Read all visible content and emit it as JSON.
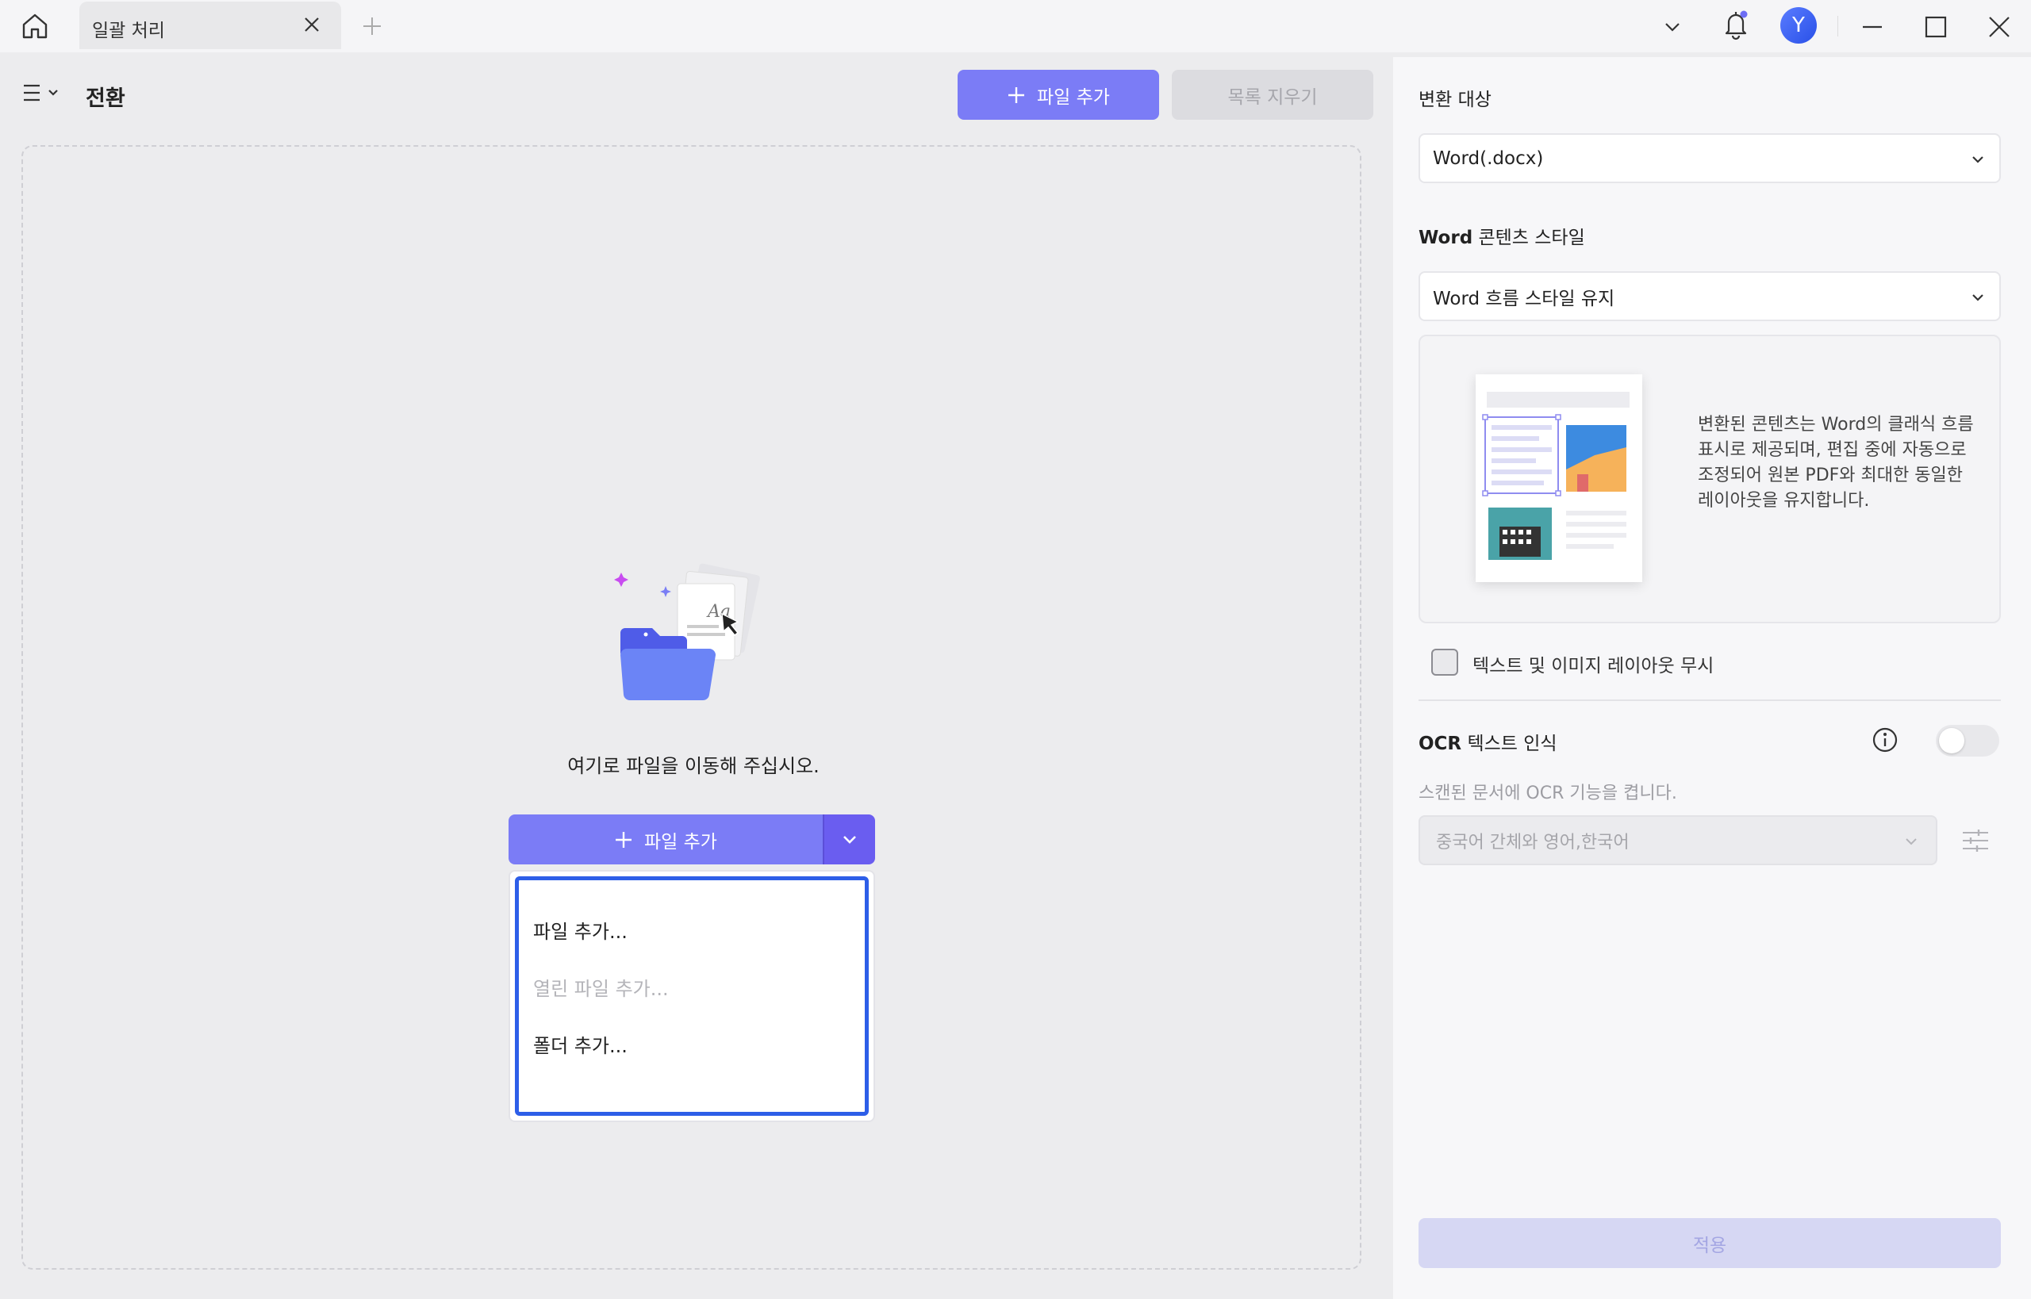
{
  "tab": {
    "title": "일괄 처리"
  },
  "header": {
    "avatar_letter": "Y"
  },
  "toolbar": {
    "page_title": "전환",
    "add_file_label": "파일 추가",
    "clear_list_label": "목록 지우기"
  },
  "dropzone": {
    "hint": "여기로 파일을 이동해 주십시오.",
    "add_file_label": "파일 추가",
    "menu": [
      {
        "label": "파일 추가...",
        "enabled": true
      },
      {
        "label": "열린 파일 추가...",
        "enabled": false
      },
      {
        "label": "폴더 추가...",
        "enabled": true
      }
    ]
  },
  "settings": {
    "target_label": "변환 대상",
    "target_value": "Word(.docx)",
    "style_label_bold": "Word",
    "style_label_rest": " 콘텐츠 스타일",
    "style_value": "Word 흐름 스타일 유지",
    "style_description": "변환된 콘텐츠는 Word의 클래식 흐름 표시로 제공되며, 편집 중에 자동으로 조정되어 원본 PDF와 최대한 동일한 레이아웃을 유지합니다.",
    "ignore_layout_label": "텍스트 및 이미지 레이아웃 무시",
    "ignore_layout_checked": false,
    "ocr_title_bold": "OCR",
    "ocr_title_rest": " 텍스트 인식",
    "ocr_enabled": false,
    "ocr_description": "스캔된 문서에 OCR 기능을 켭니다.",
    "ocr_language": "중국어 간체와 영어,한국어",
    "apply_label": "적용"
  },
  "colors": {
    "accent": "#7b7cf6",
    "accent_dark": "#6a5df0",
    "menu_focus": "#2d5ee8",
    "disabled_text": "#a6a6ac"
  }
}
